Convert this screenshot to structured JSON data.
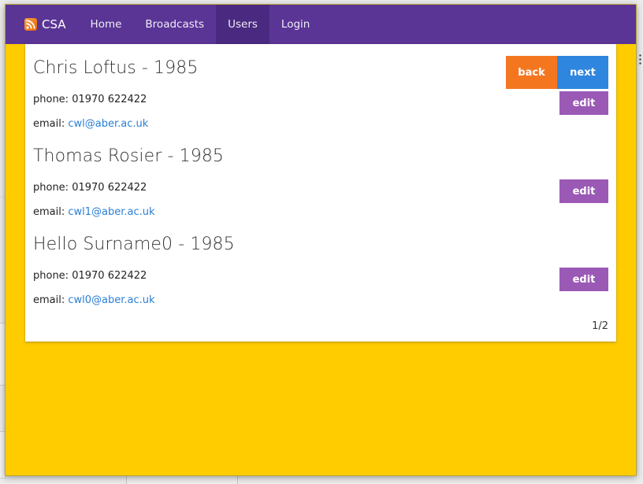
{
  "nav": {
    "brand": "CSA",
    "items": [
      {
        "label": "Home",
        "active": false
      },
      {
        "label": "Broadcasts",
        "active": false
      },
      {
        "label": "Users",
        "active": true
      },
      {
        "label": "Login",
        "active": false
      }
    ]
  },
  "pagination": {
    "back_label": "back",
    "next_label": "next",
    "page_indicator": "1/2"
  },
  "users": [
    {
      "name": "Chris Loftus - 1985",
      "phone_label": "phone:",
      "phone": "01970 622422",
      "email_label": "email:",
      "email": "cwl@aber.ac.uk",
      "edit_label": "edit"
    },
    {
      "name": "Thomas Rosier - 1985",
      "phone_label": "phone:",
      "phone": "01970 622422",
      "email_label": "email:",
      "email": "cwl1@aber.ac.uk",
      "edit_label": "edit"
    },
    {
      "name": "Hello Surname0 - 1985",
      "phone_label": "phone:",
      "phone": "01970 622422",
      "email_label": "email:",
      "email": "cwl0@aber.ac.uk",
      "edit_label": "edit"
    }
  ],
  "colors": {
    "navbar": "#5a3595",
    "navbar_active": "#4a2a80",
    "page_background": "#ffcc00",
    "edit_button": "#9b59b6",
    "back_button": "#f47720",
    "next_button": "#2e86de",
    "link": "#2a7fd4"
  },
  "icons": {
    "brand": "rss-icon"
  }
}
